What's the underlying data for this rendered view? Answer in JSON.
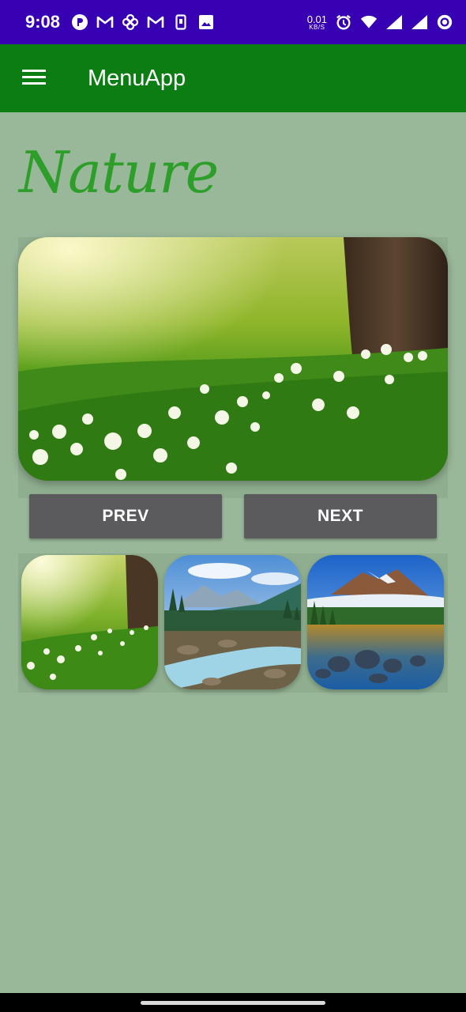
{
  "status_bar": {
    "time": "9:08",
    "net_speed_value": "0.01",
    "net_speed_unit": "KB/S",
    "icons_left": [
      "app-r-icon",
      "gmail-icon",
      "pinwheel-icon",
      "gmail-icon",
      "phone-icon",
      "image-icon"
    ],
    "icons_right": [
      "alarm-icon",
      "wifi-icon",
      "signal-icon",
      "signal-icon",
      "ring-icon"
    ],
    "background": "#3700b3"
  },
  "app_bar": {
    "title": "MenuApp",
    "menu_icon": "hamburger-icon",
    "background": "#0c7d12"
  },
  "page": {
    "heading": "Nature",
    "heading_color": "#2e9e2a",
    "background": "#99b799"
  },
  "main_image": {
    "scene": "meadow-tree-flowers"
  },
  "buttons": {
    "prev_label": "PREV",
    "next_label": "NEXT",
    "color": "#5b5a5d"
  },
  "thumbnails": [
    {
      "scene": "meadow-tree-flowers"
    },
    {
      "scene": "mountain-river-forest"
    },
    {
      "scene": "mountain-lake-rocks"
    }
  ]
}
